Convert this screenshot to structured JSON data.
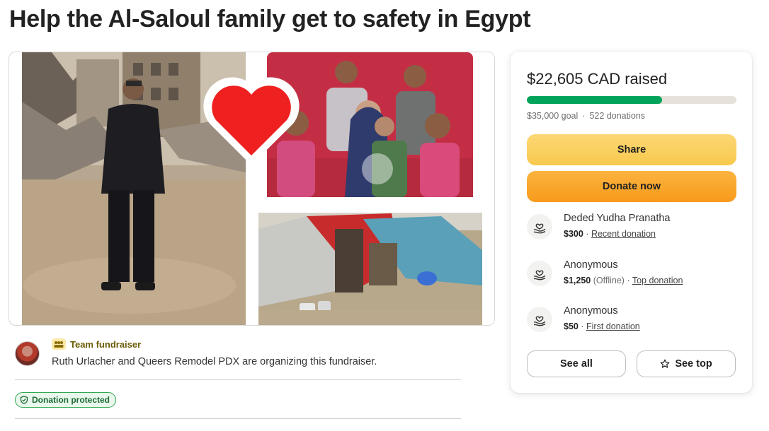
{
  "page": {
    "title": "Help the Al-Saloul family get to safety in Egypt"
  },
  "organizer": {
    "badge": "Team fundraiser",
    "text": "Ruth Urlacher and Queers Remodel PDX are organizing this fundraiser."
  },
  "protection": {
    "label": "Donation protected"
  },
  "donation_card": {
    "raised": "$22,605 CAD raised",
    "progress_fraction": 0.646,
    "goal": "$35,000 goal",
    "separator": "·",
    "donations": "522 donations",
    "share_label": "Share",
    "donate_label": "Donate now",
    "donors": [
      {
        "name": "Deded Yudha Pranatha",
        "amount": "$300",
        "note": "",
        "tag": "Recent donation"
      },
      {
        "name": "Anonymous",
        "amount": "$1,250",
        "note": "(Offline)",
        "tag": "Top donation"
      },
      {
        "name": "Anonymous",
        "amount": "$50",
        "note": "",
        "tag": "First donation"
      }
    ],
    "see_all_label": "See all",
    "see_top_label": "See top"
  },
  "colors": {
    "progress": "#01a35a",
    "share": "#f7c94c",
    "donate": "#f79a1b",
    "protected": "#2fa84f"
  },
  "icons": {
    "team": "team-icon",
    "shield": "shield-icon",
    "donor": "heart-hand-icon",
    "star": "star-icon",
    "heart": "heart-icon"
  }
}
